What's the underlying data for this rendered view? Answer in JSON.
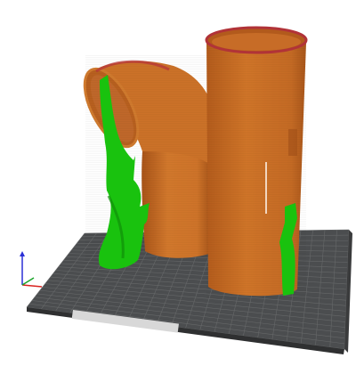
{
  "app": {
    "view": "3d-preview"
  },
  "bed": {
    "label": "",
    "colors": {
      "surface": "#4b4d4f",
      "grid": "#666869",
      "edge": "#2f3031"
    }
  },
  "models": [
    {
      "name": "curved-pipe",
      "color": "#cf7429"
    },
    {
      "name": "tall-cylinder",
      "color": "#c96a25"
    }
  ],
  "supports": {
    "color": "#19c20e"
  },
  "axes": {
    "x_color": "#d9231f",
    "y_color": "#1aa52a",
    "z_color": "#2a2fd6"
  }
}
